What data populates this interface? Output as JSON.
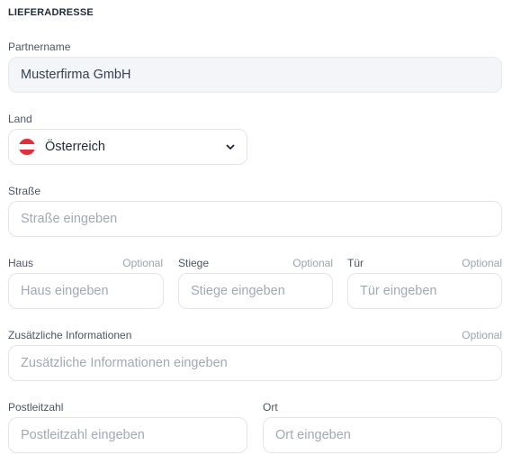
{
  "section": {
    "title": "LIEFERADRESSE"
  },
  "partner": {
    "label": "Partnername",
    "value": "Musterfirma GmbH"
  },
  "country": {
    "label": "Land",
    "value": "Österreich",
    "flag_icon": "austria-flag-icon",
    "flag_colors": [
      "#e0313b",
      "#ffffff",
      "#e0313b"
    ]
  },
  "street": {
    "label": "Straße",
    "placeholder": "Straße eingeben"
  },
  "house": {
    "label": "Haus",
    "optional": "Optional",
    "placeholder": "Haus eingeben"
  },
  "stair": {
    "label": "Stiege",
    "optional": "Optional",
    "placeholder": "Stiege eingeben"
  },
  "door": {
    "label": "Tür",
    "optional": "Optional",
    "placeholder": "Tür eingeben"
  },
  "additional": {
    "label": "Zusätzliche Informationen",
    "optional": "Optional",
    "placeholder": "Zusätzliche Informationen eingeben"
  },
  "postal": {
    "label": "Postleitzahl",
    "placeholder": "Postleitzahl eingeben"
  },
  "city": {
    "label": "Ort",
    "placeholder": "Ort eingeben"
  }
}
